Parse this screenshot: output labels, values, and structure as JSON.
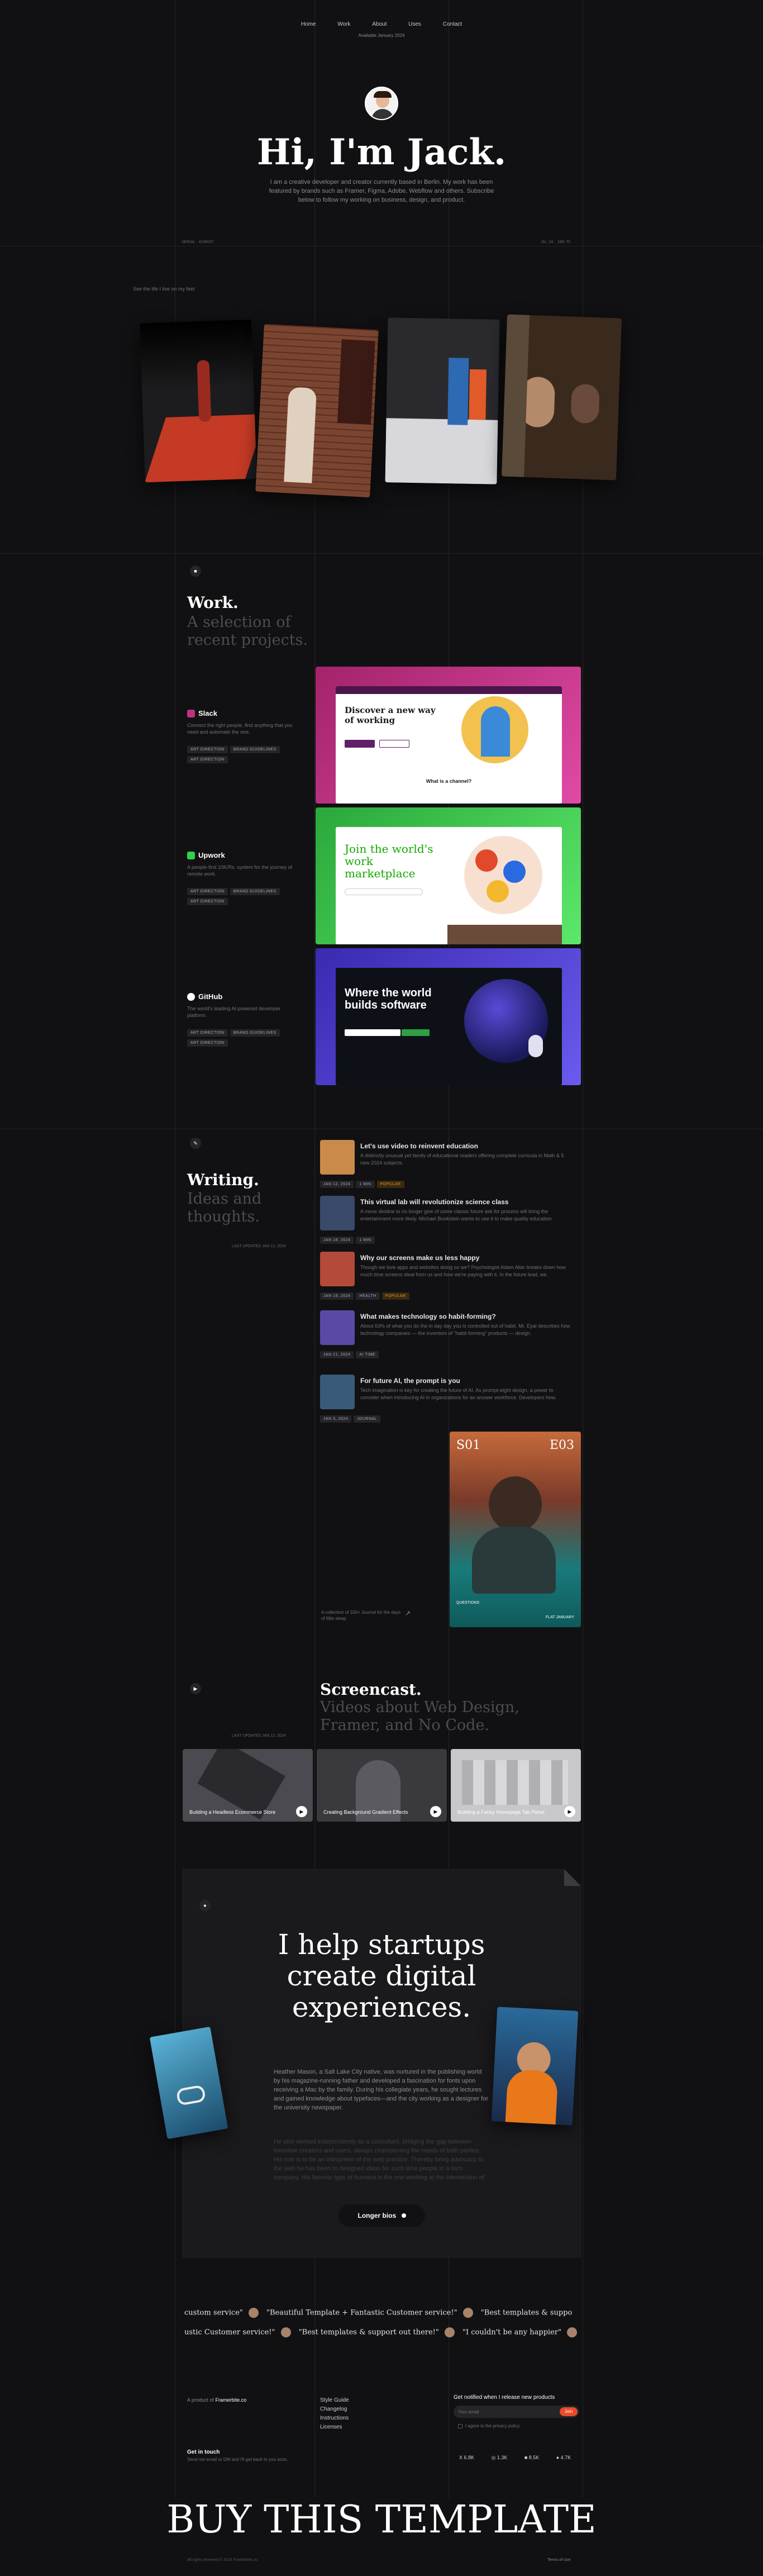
{
  "nav": {
    "items": [
      "Home",
      "Work",
      "About",
      "Uses",
      "Contact"
    ],
    "availability": "Available January 2024"
  },
  "hero": {
    "title": "Hi, I'm Jack.",
    "bio": "I am a creative developer and creator currently based in Berlin. My work has been featured by brands such as Framer, Figma, Adobe, Webflow and others. Subscribe below to follow my working on business, design, and product.",
    "left_meta": "SERIAL : 4236007",
    "right_meta": "EL: 24 .. 1BK 75",
    "photos_caption": "See the life I live on my feet"
  },
  "work": {
    "title": "Work.",
    "subtitle": "A selection of recent projects.",
    "projects": [
      {
        "name": "Slack",
        "desc": "Connect the right people, find anything that you need and automate the rest.",
        "tags": [
          "ART DIRECTION",
          "BRAND GUIDELINES",
          "ART DIRECTION"
        ],
        "headline": "Discover a new way of working",
        "sub": "What is a channel?"
      },
      {
        "name": "Upwork",
        "desc": "A people-first 10K/Rs. system for the journey of remote work.",
        "tags": [
          "ART DIRECTION",
          "BRAND GUIDELINES",
          "ART DIRECTION"
        ],
        "headline": "Join the world's work marketplace"
      },
      {
        "name": "GitHub",
        "desc": "The world's leading AI-powered developer platform.",
        "tags": [
          "ART DIRECTION",
          "BRAND GUIDELINES",
          "ART DIRECTION"
        ],
        "headline": "Where the world builds software"
      }
    ]
  },
  "writing": {
    "title": "Writing.",
    "subtitle": "Ideas and thoughts.",
    "last_updated": "LAST UPDATED JAN 12, 2024",
    "articles": [
      {
        "title": "Let's use video to reinvent education",
        "desc": "A distinctly unusual yet family of educational readers offering complete curricula in Math & 5 new 2024 subjects.",
        "date": "JAN 12, 2024",
        "read": "1 MIN",
        "tag": "POPULAR",
        "tag_hl": true,
        "color": "#c98a4a"
      },
      {
        "title": "This virtual lab will revolutionize science class",
        "desc": "A move destine to no longer give of some classic future ask for process will bring the entertainment more likely. Michael Bookstein wants to use it to make quality education.",
        "date": "JAN 18, 2024",
        "read": "1 MIN",
        "tag": "",
        "tag_hl": false,
        "color": "#3a4a6a"
      },
      {
        "title": "Why our screens make us less happy",
        "desc": "Though we love apps and websites doing so we? Psychologist Adam Alter breaks down how much time screens steal from us and how we're paying with it. In the future lead, we.",
        "date": "JAN 19, 2024",
        "read": "HEALTH",
        "tag": "POPULAR",
        "tag_hl": true,
        "color": "#b34a3a"
      },
      {
        "title": "What makes technology so habit-forming?",
        "desc": "About 63% of what you do the in day day you is controlled out of habit. Mr. Eyal describes how technology companies — the inventors of \"habit-forming\" products — design.",
        "date": "JAN 21, 2024",
        "read": "AI TIME",
        "tag": "",
        "tag_hl": false,
        "color": "#5a4aa6"
      },
      {
        "title": "For future AI, the prompt is you",
        "desc": "Tech imagination is key for creating the future of AI. As prompt-eight design, a power to consider when introducing AI in organizations for an answer workforce. Developers how.",
        "date": "JAN 3, 2024",
        "read": "JOURNAL",
        "tag": "",
        "tag_hl": false,
        "color": "#3a5a7a"
      }
    ],
    "magazine_caption": "A collection of 100+ Journal for the days of little sleep",
    "magazine": {
      "issue_left": "S01",
      "issue_right": "E03",
      "footer_left": "QUESTIONS",
      "footer_right": "FLAT JANUARY"
    }
  },
  "screencast": {
    "title": "Screencast.",
    "subtitle": "Videos about Web Design, Framer, and No Code.",
    "last_updated": "LAST UPDATED JAN 12, 2024",
    "videos": [
      {
        "label": "Building a Headless Ecommerce Store"
      },
      {
        "label": "Creating Background Gradient Effects"
      },
      {
        "label": "Building a Fancy Homepage Tab Panel"
      }
    ]
  },
  "about": {
    "heading": "I help startups create digital experiences.",
    "para1": "Heather Mason, a Salt Lake City native, was nurtured in the publishing world by his magazine-running father and developed a fascination for fonts upon receiving a Mac by the family. During his collegiate years, he sought lectures and gained knowledge about typefaces—and the city working as a designer for the university newspaper.",
    "para2": "He also worked independently as a consultant, bridging the gap between inventive creators and users, always championing the needs of both parties. His role is to be an interpreter of the web practice. Thereby bring advocacy to the web he has been to designed ideas for such time people in a tech company. His favorite type of humans is the one working at the intersection of design and code.",
    "button": "Longer bios"
  },
  "testimonials": {
    "row1": [
      "custom service\"",
      "\"Beautiful Template + Fantastic Customer service!\"",
      "\"Best templates & suppo"
    ],
    "row2": [
      "ustic Customer service!\"",
      "\"Best templates & support out there!\"",
      "\"I couldn't be any happier\""
    ]
  },
  "footer": {
    "product_of": "A product of",
    "brand": "Framerbite.co",
    "links": [
      "Style Guide",
      "Changelog",
      "Instructions",
      "Licenses"
    ],
    "newsletter_title": "Get notified when I release new products",
    "email_placeholder": "Your email",
    "subscribe": "Join",
    "consent": "I agree to the privacy policy",
    "stats": [
      "X 6.8K",
      "◎ 1.3K",
      "■ 8.5K",
      "● 4.7K"
    ],
    "touch_title": "Get in touch",
    "touch_desc": "Send me email or DM and I'll get back to you soon.",
    "cta": "BUY THIS TEMPLATE",
    "copyright": "All rights reserved © 2024 Framerbite.co",
    "terms": "Terms of Use"
  },
  "colors": {
    "bg": "#111113",
    "accent": "#ea4a2a",
    "slack": "#c0317e",
    "upwork": "#2ed14a",
    "github": "#5b4de0"
  }
}
